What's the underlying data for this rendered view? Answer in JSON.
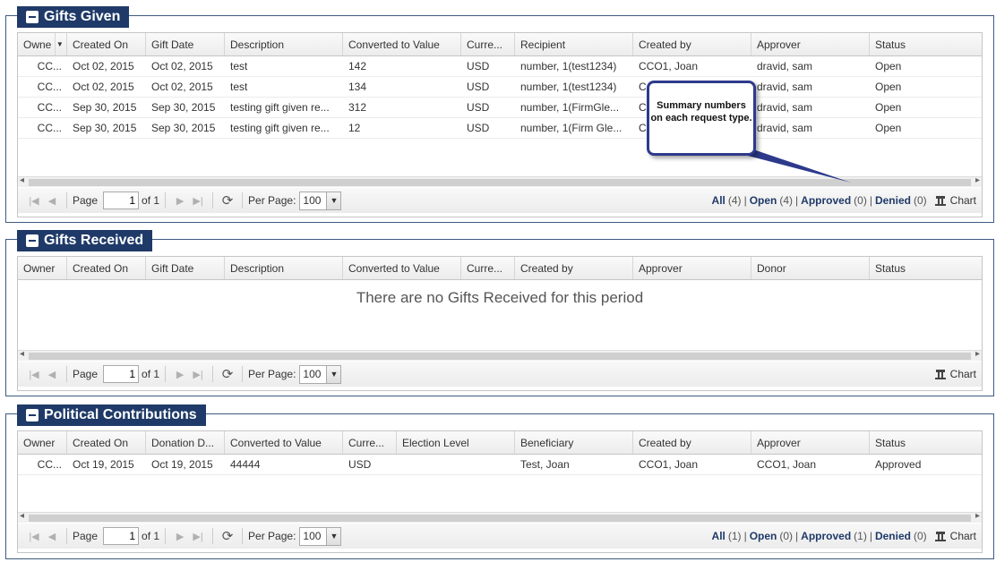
{
  "gifts_given": {
    "title": "Gifts Given",
    "columns": [
      "Owne",
      "Created On",
      "Gift Date",
      "Description",
      "Converted to Value",
      "Curre...",
      "Recipient",
      "Created by",
      "Approver",
      "Status"
    ],
    "rows": [
      [
        "CC...",
        "Oct 02, 2015",
        "Oct 02, 2015",
        "test",
        "142",
        "USD",
        "number, 1(test1234)",
        "CCO1, Joan",
        "dravid, sam",
        "Open"
      ],
      [
        "CC...",
        "Oct 02, 2015",
        "Oct 02, 2015",
        "test",
        "134",
        "USD",
        "number, 1(test1234)",
        "C",
        "dravid, sam",
        "Open"
      ],
      [
        "CC...",
        "Sep 30, 2015",
        "Sep 30, 2015",
        "testing gift given re...",
        "312",
        "USD",
        "number, 1(FirmGle...",
        "C",
        "dravid, sam",
        "Open"
      ],
      [
        "CC...",
        "Sep 30, 2015",
        "Sep 30, 2015",
        "testing gift given re...",
        "12",
        "USD",
        "number, 1(Firm Gle...",
        "C",
        "dravid, sam",
        "Open"
      ]
    ],
    "pager": {
      "page_label": "Page",
      "page_value": "1",
      "of_label": "of 1",
      "per_page_label": "Per Page:",
      "per_page_value": "100"
    },
    "summary": {
      "all_label": "All",
      "all_count": "(4)",
      "open_label": "Open",
      "open_count": "(4)",
      "approved_label": "Approved",
      "approved_count": "(0)",
      "denied_label": "Denied",
      "denied_count": "(0)",
      "chart_label": "Chart"
    }
  },
  "gifts_received": {
    "title": "Gifts Received",
    "columns": [
      "Owner",
      "Created On",
      "Gift Date",
      "Description",
      "Converted to Value",
      "Curre...",
      "Created by",
      "Approver",
      "Donor",
      "Status"
    ],
    "empty_message": "There are no Gifts Received for this period",
    "pager": {
      "page_label": "Page",
      "page_value": "1",
      "of_label": "of 1",
      "per_page_label": "Per Page:",
      "per_page_value": "100"
    },
    "summary": {
      "chart_label": "Chart"
    }
  },
  "political_contributions": {
    "title": "Political Contributions",
    "columns": [
      "Owner",
      "Created On",
      "Donation D...",
      "Converted to Value",
      "Curre...",
      "Election Level",
      "Beneficiary",
      "Created by",
      "Approver",
      "Status"
    ],
    "rows": [
      [
        "CC...",
        "Oct 19, 2015",
        "Oct 19, 2015",
        "44444",
        "USD",
        "",
        "Test, Joan",
        "CCO1, Joan",
        "CCO1, Joan",
        "Approved"
      ]
    ],
    "pager": {
      "page_label": "Page",
      "page_value": "1",
      "of_label": "of 1",
      "per_page_label": "Per Page:",
      "per_page_value": "100"
    },
    "summary": {
      "all_label": "All",
      "all_count": "(1)",
      "open_label": "Open",
      "open_count": "(0)",
      "approved_label": "Approved",
      "approved_count": "(1)",
      "denied_label": "Denied",
      "denied_count": "(0)",
      "chart_label": "Chart"
    }
  },
  "callout": {
    "text": "Summary numbers on each request type."
  },
  "colors": {
    "panel_header": "#1f3a68",
    "callout_border": "#2d3a8c",
    "summary_link": "#1f3a68"
  }
}
